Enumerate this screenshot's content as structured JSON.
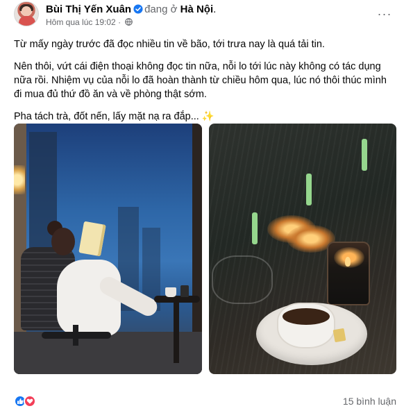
{
  "post": {
    "author_name": "Bùi Thị Yến Xuân",
    "at_text": "đang ở",
    "location": "Hà Nội",
    "location_suffix": ".",
    "timestamp": "Hôm qua lúc 19:02",
    "timestamp_sep": "·",
    "more_label": "···",
    "paragraphs": [
      "Từ mấy ngày trước đã đọc nhiều tin về bão, tới trưa nay là quá tải tin.",
      "Nên thôi, vứt cái điện thoại không đọc tin nữa, nỗi lo tới lúc này không có tác dụng nữa rồi. Nhiệm vụ của nỗi lo đã hoàn thành từ chiều hôm qua, lúc nó thôi thúc mình đi mua đủ thứ đồ ăn và về phòng thật sớm.",
      "Pha tách trà, đốt nến, lấy mặt nạ ra đắp..."
    ],
    "sparkle_emoji": "✨",
    "icons": {
      "verified": "verified-badge-icon",
      "audience": "globe-icon",
      "more": "more-options-icon",
      "like": "like-reaction-icon",
      "love": "love-reaction-icon"
    },
    "colors": {
      "accent": "#1877f2",
      "love": "#f33e58",
      "secondary_text": "#65676b"
    }
  },
  "footer": {
    "comments": "15 bình luận"
  }
}
